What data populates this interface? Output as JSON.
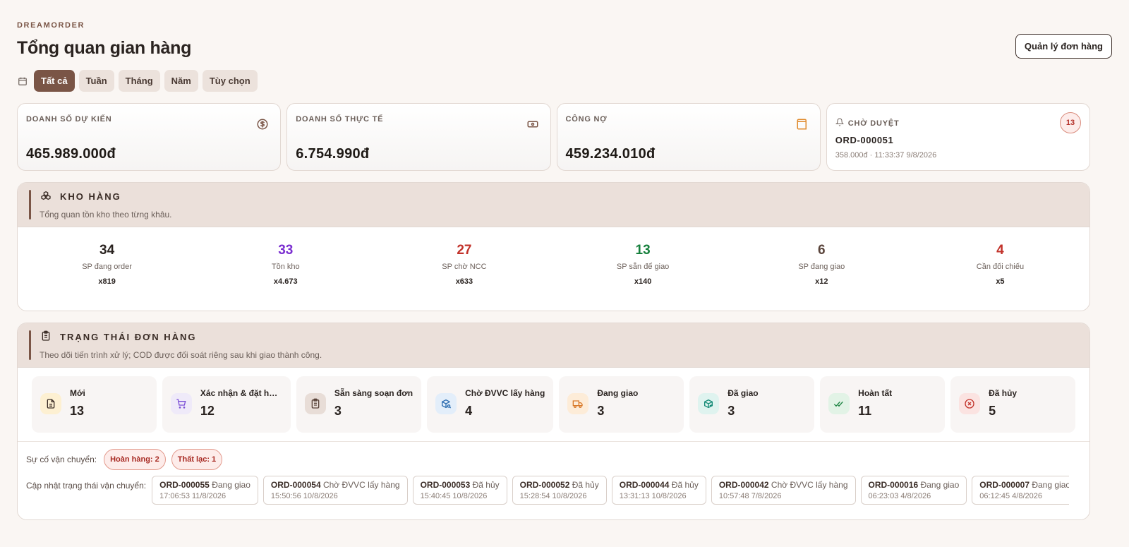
{
  "brand": "DREAMORDER",
  "title": "Tổng quan gian hàng",
  "manage_button": "Quản lý đơn hàng",
  "filters": [
    {
      "label": "Tất cả",
      "active": true
    },
    {
      "label": "Tuần",
      "active": false
    },
    {
      "label": "Tháng",
      "active": false
    },
    {
      "label": "Năm",
      "active": false
    },
    {
      "label": "Tùy chọn",
      "active": false
    }
  ],
  "stats": {
    "expected": {
      "label": "DOANH SỐ DỰ KIẾN",
      "value": "465.989.000đ",
      "icon": "dollar-icon",
      "color": "#7a5546"
    },
    "actual": {
      "label": "DOANH SỐ THỰC TẾ",
      "value": "6.754.990đ",
      "icon": "banknote-icon",
      "color": "#7a5546"
    },
    "debt": {
      "label": "CÔNG NỢ",
      "value": "459.234.010đ",
      "icon": "wallet-icon",
      "color": "#e08a2c"
    },
    "pending": {
      "label": "CHỜ DUYỆT",
      "order": "ORD-000051",
      "meta": "358.000đ · 11:33:37 9/8/2026",
      "count": "13",
      "icon": "bell-icon"
    }
  },
  "inventory": {
    "title": "KHO HÀNG",
    "subtitle": "Tổng quan tồn kho theo từng khâu.",
    "items": [
      {
        "value": "34",
        "label": "SP đang order",
        "qty": "x819",
        "color": "#2a2320"
      },
      {
        "value": "33",
        "label": "Tồn kho",
        "qty": "x4.673",
        "color": "#7b2fd0"
      },
      {
        "value": "27",
        "label": "SP chờ NCC",
        "qty": "x633",
        "color": "#c2322a"
      },
      {
        "value": "13",
        "label": "SP sẵn để giao",
        "qty": "x140",
        "color": "#17803d"
      },
      {
        "value": "6",
        "label": "SP đang giao",
        "qty": "x12",
        "color": "#5a443b"
      },
      {
        "value": "4",
        "label": "Cần đối chiếu",
        "qty": "x5",
        "color": "#c2322a"
      }
    ]
  },
  "orders": {
    "title": "TRẠNG THÁI ĐƠN HÀNG",
    "subtitle": "Theo dõi tiến trình xử lý; COD được đối soát riêng sau khi giao thành công.",
    "statuses": [
      {
        "label": "Mới",
        "count": "13",
        "icon": "document-icon",
        "bg": "#fdf0d2",
        "fg": "#b8860b"
      },
      {
        "label": "Xác nhận & đặt hàng",
        "count": "12",
        "icon": "cart-icon",
        "bg": "#efeaf9",
        "fg": "#7b4fd6"
      },
      {
        "label": "Sẵn sàng soạn đơn",
        "count": "3",
        "icon": "clipboard-icon",
        "bg": "#e8ddd7",
        "fg": "#5a443b"
      },
      {
        "label": "Chờ ĐVVC lấy hàng",
        "count": "4",
        "icon": "package-search-icon",
        "bg": "#e3eefa",
        "fg": "#2b6cb0"
      },
      {
        "label": "Đang giao",
        "count": "3",
        "icon": "truck-icon",
        "bg": "#fdecd8",
        "fg": "#d97a2b"
      },
      {
        "label": "Đã giao",
        "count": "3",
        "icon": "package-check-icon",
        "bg": "#dff3ef",
        "fg": "#138a76"
      },
      {
        "label": "Hoàn tất",
        "count": "11",
        "icon": "double-check-icon",
        "bg": "#e2f3e6",
        "fg": "#17803d"
      },
      {
        "label": "Đã hủy",
        "count": "5",
        "icon": "cancel-circle-icon",
        "bg": "#fbe3e1",
        "fg": "#c2322a"
      }
    ],
    "issues_label": "Sự cố vận chuyển:",
    "issues": [
      "Hoàn hàng: 2",
      "Thất lạc: 1"
    ],
    "updates_label": "Cập nhật trạng thái vận chuyển:",
    "updates": [
      {
        "id": "ORD-000055",
        "status": "Đang giao",
        "time": "17:06:53 11/8/2026"
      },
      {
        "id": "ORD-000054",
        "status": "Chờ ĐVVC lấy hàng",
        "time": "15:50:56 10/8/2026"
      },
      {
        "id": "ORD-000053",
        "status": "Đã hủy",
        "time": "15:40:45 10/8/2026"
      },
      {
        "id": "ORD-000052",
        "status": "Đã hủy",
        "time": "15:28:54 10/8/2026"
      },
      {
        "id": "ORD-000044",
        "status": "Đã hủy",
        "time": "13:31:13 10/8/2026"
      },
      {
        "id": "ORD-000042",
        "status": "Chờ ĐVVC lấy hàng",
        "time": "10:57:48 7/8/2026"
      },
      {
        "id": "ORD-000016",
        "status": "Đang giao",
        "time": "06:23:03 4/8/2026"
      },
      {
        "id": "ORD-000007",
        "status": "Đang giao",
        "time": "06:12:45 4/8/2026"
      }
    ]
  }
}
